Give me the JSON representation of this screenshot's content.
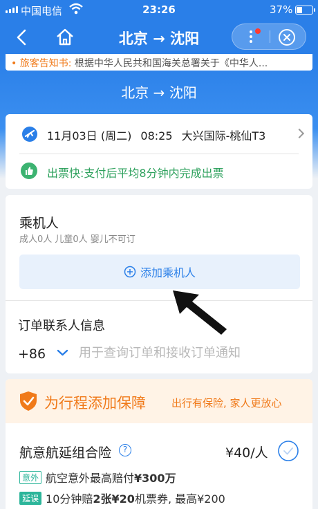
{
  "status_bar": {
    "carrier": "中国电信",
    "time": "23:26",
    "battery": "37%",
    "battery_level": 0.37
  },
  "nav": {
    "title": "北京 → 沈阳"
  },
  "notice": {
    "label": "• 旅客告知书:",
    "text": "根据中华人民共和国海关总署关于《中华人..."
  },
  "route_title": "北京 → 沈阳",
  "flight": {
    "date": "11月03日",
    "weekday": "(周二)",
    "time": "08:25",
    "airport": "大兴国际-桃仙T3",
    "fast_ticket": "出票快:支付后平均8分钟内完成出票"
  },
  "passengers": {
    "title": "乘机人",
    "summary": "成人0人 儿童0人 婴儿不可订",
    "add_button": "添加乘机人",
    "contact_title": "订单联系人信息",
    "country_code": "+86",
    "phone_placeholder": "用于查询订单和接收订单通知"
  },
  "insurance": {
    "banner_title": "为行程添加保障",
    "banner_slogan": "出行有保险, 家人更放心",
    "product_name": "航意航延组合险",
    "help": "?",
    "price": "¥40/人",
    "lines": [
      {
        "tag": "意外",
        "prefix": "航空意外最高赔付",
        "highlight": "¥300万",
        "suffix": ""
      },
      {
        "tag": "延误",
        "prefix": "10分钟赔",
        "highlight": "2张¥20",
        "suffix": "机票券, 最高¥200"
      }
    ]
  },
  "colors": {
    "brand": "#2a7fe8",
    "orange": "#f07a1a",
    "green": "#2ea15d"
  }
}
